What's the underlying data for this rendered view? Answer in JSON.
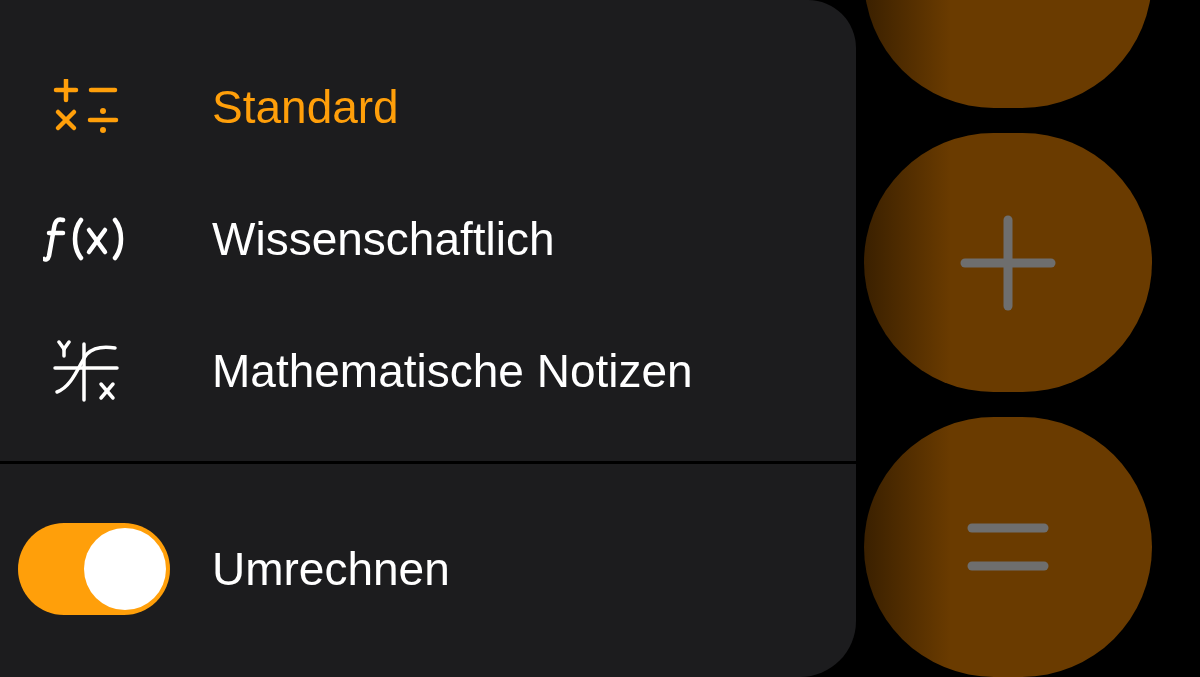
{
  "menu": {
    "items": [
      {
        "kind": "standard",
        "label": "Standard",
        "selected": true
      },
      {
        "kind": "scientific",
        "label": "Wissenschaftlich",
        "selected": false
      },
      {
        "kind": "notes",
        "label": "Mathematische Notizen",
        "selected": false
      }
    ],
    "toggle": {
      "label": "Umrechnen",
      "on": true
    }
  },
  "keypad": {
    "keys": [
      {
        "kind": "blank"
      },
      {
        "kind": "plus"
      },
      {
        "kind": "equals"
      }
    ]
  }
}
